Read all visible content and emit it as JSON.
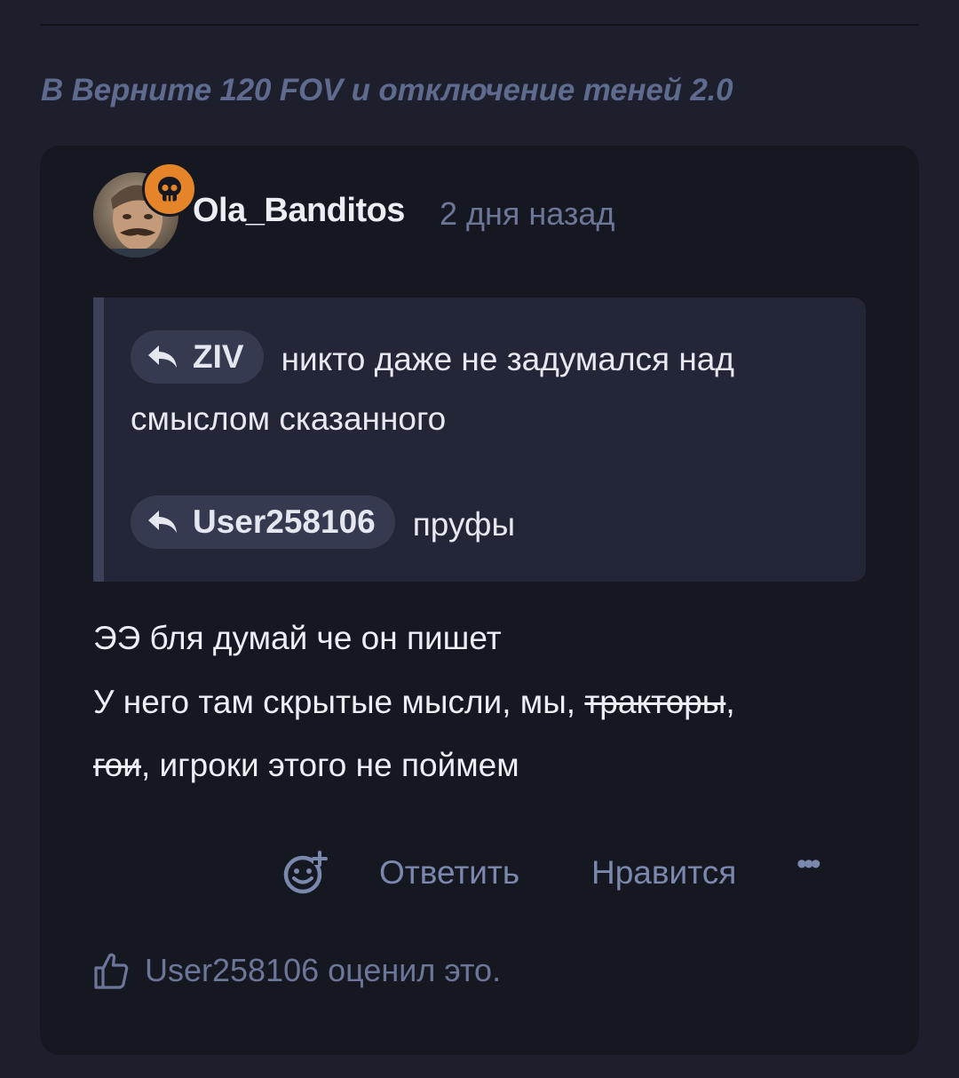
{
  "thread": {
    "title": "В Верните 120 FOV и отключение теней 2.0"
  },
  "post": {
    "author": {
      "username": "Ola_Banditos",
      "avatar_icon": "user-photo-avatar",
      "badge_icon": "skull-icon",
      "badge_color": "#e6842a"
    },
    "time": "2 дня назад",
    "quote": {
      "first_mention": "ZIV",
      "first_text_line1": "никто даже не задумался над",
      "first_text_line2": "смыслом сказанного",
      "second_mention": "User258106",
      "second_text": "пруфы"
    },
    "body": {
      "line1": "ЭЭ бля думай че он пишет",
      "line2_start": "У него там скрытые мысли, мы, ",
      "line2_strike": "тракторы",
      "line2_end": ",",
      "line3_strike": "гои",
      "line3_end": ", игроки этого не поймем"
    },
    "actions": {
      "reaction_icon": "add-reaction-icon",
      "reply": "Ответить",
      "like": "Нравится",
      "more": "•••"
    },
    "liked_by": "User258106 оценил это."
  },
  "colors": {
    "background": "#1d1f2c",
    "card": "#161821",
    "quote_bg": "#232637",
    "muted": "#6b7699",
    "action": "#7b88ad",
    "accent": "#e6842a"
  }
}
